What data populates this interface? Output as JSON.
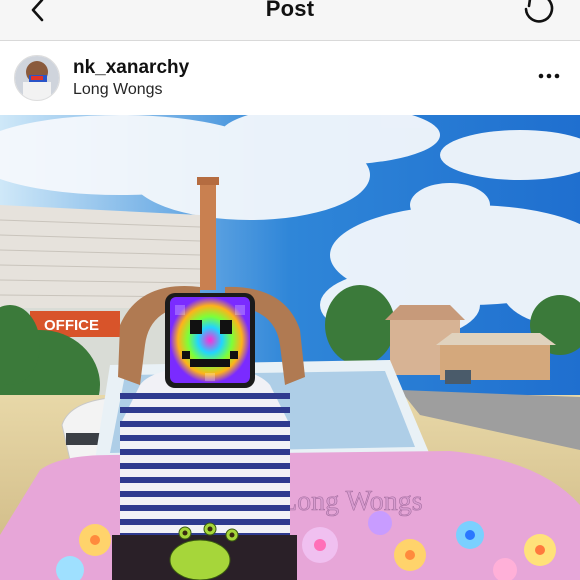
{
  "topbar": {
    "title": "Post",
    "back_icon": "chevron-left-icon",
    "refresh_icon": "refresh-icon"
  },
  "post": {
    "username": "nk_xanarchy",
    "location": "Long Wongs",
    "more_icon": "more-horizontal-icon",
    "building_sign": "OFFICE",
    "car_lettering": "Long Wongs"
  },
  "colors": {
    "sky": "#2f86d8",
    "car_pink": "#e7a6d8",
    "bar_bg": "#f6f6f6"
  }
}
